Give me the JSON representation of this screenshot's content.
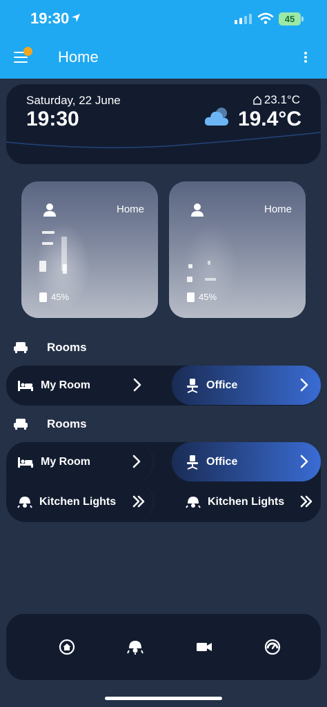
{
  "status_bar": {
    "time": "19:30",
    "battery": "45"
  },
  "app_bar": {
    "title": "Home"
  },
  "clock_card": {
    "date": "Saturday, 22 June",
    "time": "19:30",
    "indoor_temp": "23.1°C",
    "outdoor_temp": "19.4°C",
    "weather_icon": "cloud-sun-icon"
  },
  "cameras": [
    {
      "label": "Home",
      "stat": "45%"
    },
    {
      "label": "Home",
      "stat": "45%"
    }
  ],
  "sections": [
    {
      "title": "Rooms",
      "items": [
        {
          "label": "My Room",
          "icon": "bed-icon",
          "active": false
        },
        {
          "label": "Office",
          "icon": "office-chair-icon",
          "active": true
        }
      ]
    },
    {
      "title": "Rooms",
      "items": [
        {
          "label": "My Room",
          "icon": "bed-icon",
          "active": false
        },
        {
          "label": "Office",
          "icon": "office-chair-icon",
          "active": true
        },
        {
          "label": "Kitchen Lights",
          "icon": "ceiling-light-icon",
          "active": false
        },
        {
          "label": "Kitchen Lights",
          "icon": "ceiling-light-icon",
          "active": false
        }
      ]
    }
  ],
  "bottom_nav": [
    "home-icon",
    "lights-icon",
    "camera-icon",
    "speedometer-icon"
  ],
  "colors": {
    "app_bar": "#1fa9f2",
    "background": "#243147",
    "card": "#131c2f",
    "accent": "#3a6cd4",
    "notification_dot": "#f2a71f"
  }
}
